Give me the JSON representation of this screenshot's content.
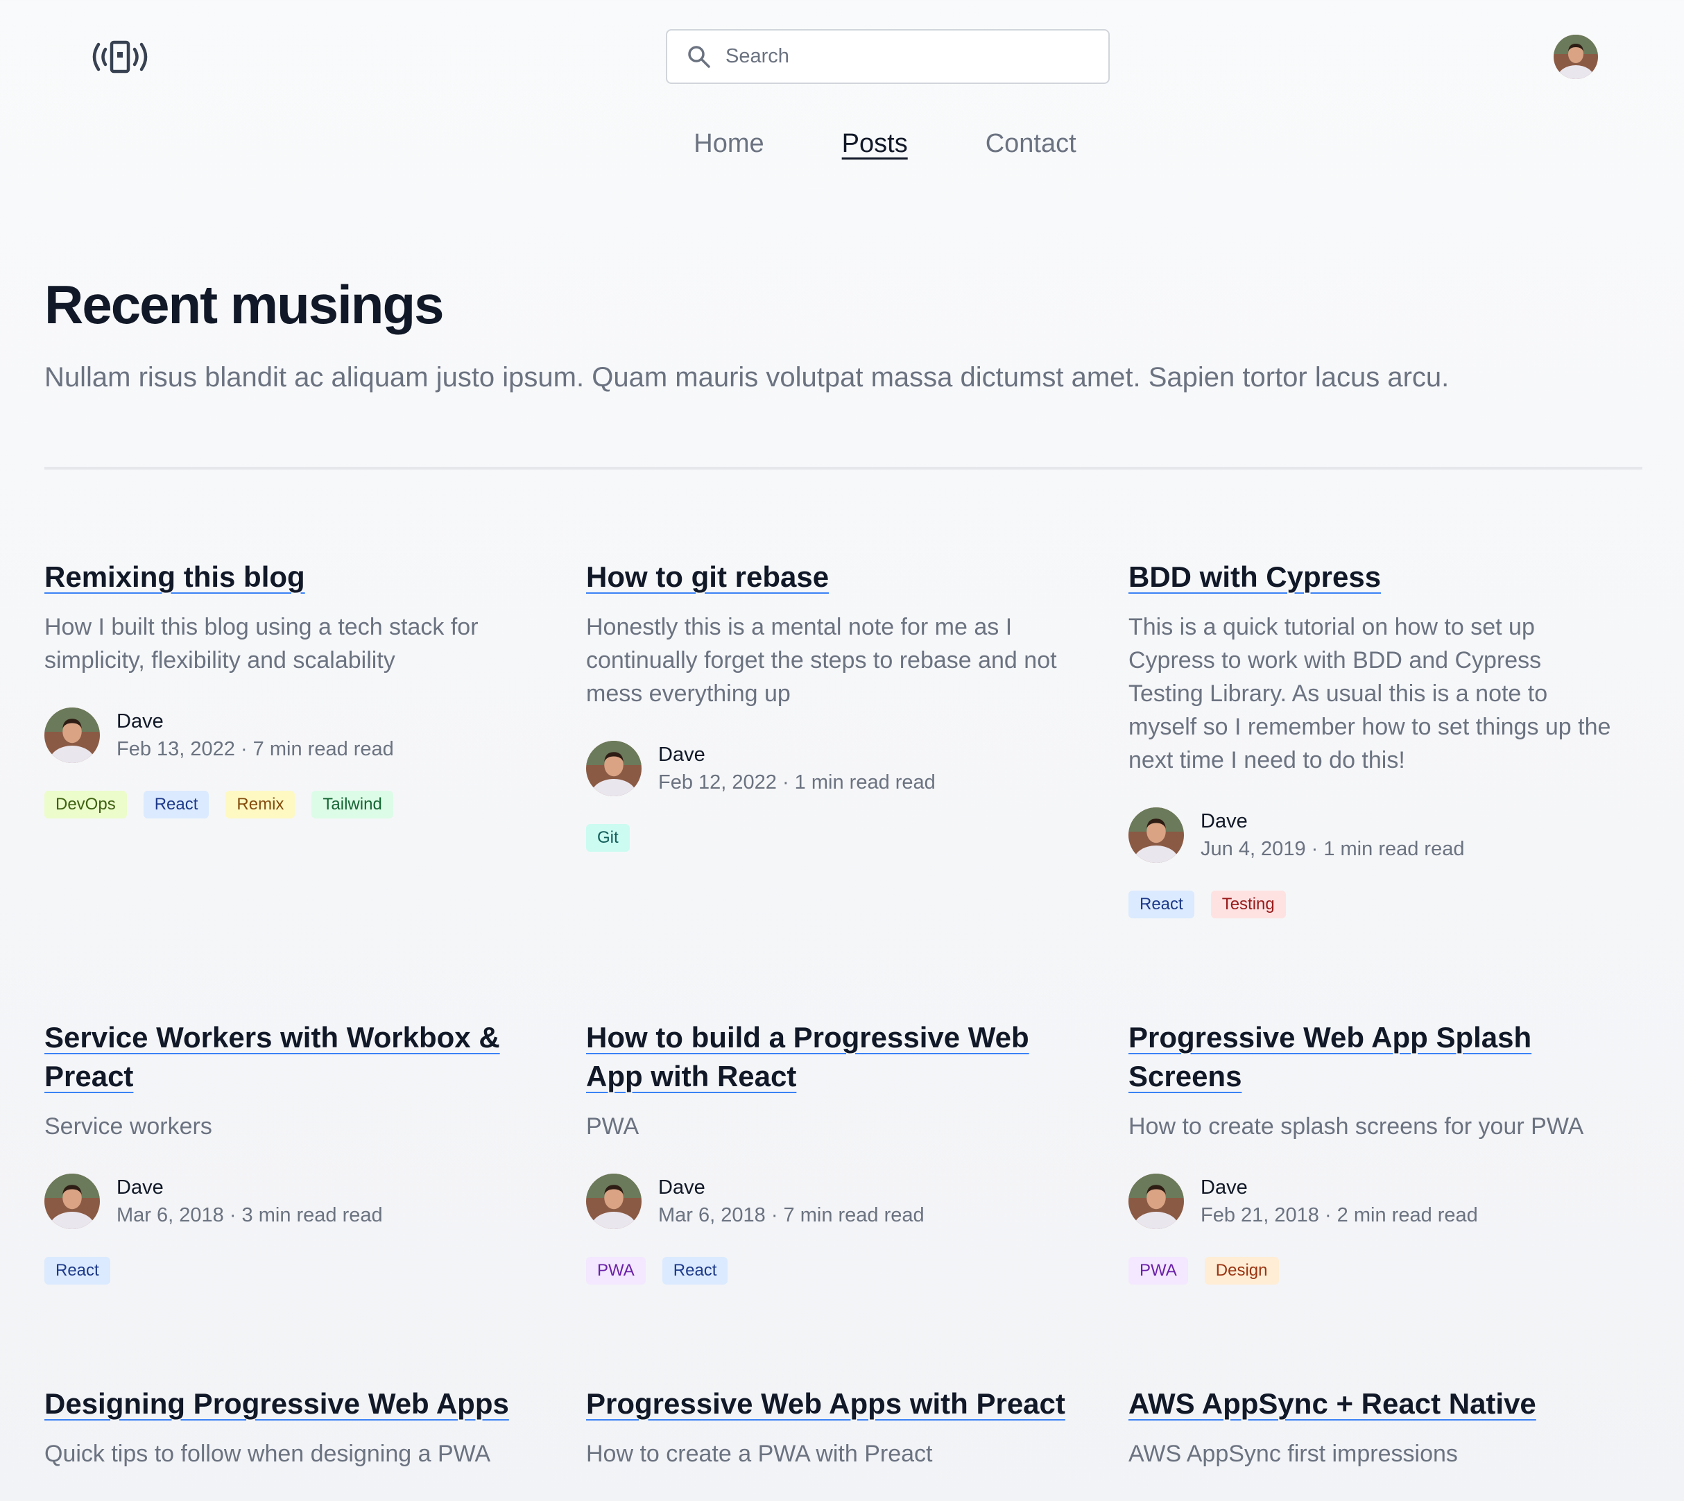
{
  "header": {
    "logo_icon": "broadcast-device-icon",
    "search": {
      "placeholder": "Search",
      "icon": "search-icon"
    },
    "avatar": "user-avatar"
  },
  "nav": [
    {
      "label": "Home",
      "active": false
    },
    {
      "label": "Posts",
      "active": true
    },
    {
      "label": "Contact",
      "active": false
    }
  ],
  "hero": {
    "title": "Recent musings",
    "subtitle": "Nullam risus blandit ac aliquam justo ipsum. Quam mauris volutpat massa dictumst amet. Sapien tortor lacus arcu."
  },
  "tag_colors": {
    "DevOps": {
      "bg": "#ecfccb",
      "fg": "#3f6212"
    },
    "React": {
      "bg": "#dbeafe",
      "fg": "#1e3a8a"
    },
    "Remix": {
      "bg": "#fef9c3",
      "fg": "#854d0e"
    },
    "Tailwind": {
      "bg": "#dcfce7",
      "fg": "#166534"
    },
    "Git": {
      "bg": "#ccfbf1",
      "fg": "#115e59"
    },
    "Testing": {
      "bg": "#fee2e2",
      "fg": "#991b1b"
    },
    "PWA": {
      "bg": "#f3e8ff",
      "fg": "#6b21a8"
    },
    "Design": {
      "bg": "#ffedd5",
      "fg": "#9a3412"
    }
  },
  "posts": [
    {
      "title": "Remixing this blog",
      "description": "How I built this blog using a tech stack for simplicity, flexibility and scalability",
      "author": "Dave",
      "date_line": "Feb 13, 2022 · 7 min read read",
      "tags": [
        "DevOps",
        "React",
        "Remix",
        "Tailwind"
      ]
    },
    {
      "title": "How to git rebase",
      "description": "Honestly this is a mental note for me as I continually forget the steps to rebase and not mess everything up",
      "author": "Dave",
      "date_line": "Feb 12, 2022 · 1 min read read",
      "tags": [
        "Git"
      ]
    },
    {
      "title": "BDD with Cypress",
      "description": "This is a quick tutorial on how to set up Cypress to work with BDD and Cypress Testing Library. As usual this is a note to myself so I remember how to set things up the next time I need to do this!",
      "author": "Dave",
      "date_line": "Jun 4, 2019 · 1 min read read",
      "tags": [
        "React",
        "Testing"
      ]
    },
    {
      "title": "Service Workers with Workbox & Preact",
      "description": "Service workers",
      "author": "Dave",
      "date_line": "Mar 6, 2018 · 3 min read read",
      "tags": [
        "React"
      ]
    },
    {
      "title": "How to build a Progressive Web App with React",
      "description": "PWA",
      "author": "Dave",
      "date_line": "Mar 6, 2018 · 7 min read read",
      "tags": [
        "PWA",
        "React"
      ]
    },
    {
      "title": "Progressive Web App Splash Screens",
      "description": "How to create splash screens for your PWA",
      "author": "Dave",
      "date_line": "Feb 21, 2018 · 2 min read read",
      "tags": [
        "PWA",
        "Design"
      ]
    },
    {
      "title": "Designing Progressive Web Apps",
      "description": "Quick tips to follow when designing a PWA",
      "author": "",
      "date_line": "",
      "tags": []
    },
    {
      "title": "Progressive Web Apps with Preact",
      "description": "How to create a PWA with Preact",
      "author": "",
      "date_line": "",
      "tags": []
    },
    {
      "title": "AWS AppSync + React Native",
      "description": "AWS AppSync first impressions",
      "author": "",
      "date_line": "",
      "tags": []
    }
  ]
}
